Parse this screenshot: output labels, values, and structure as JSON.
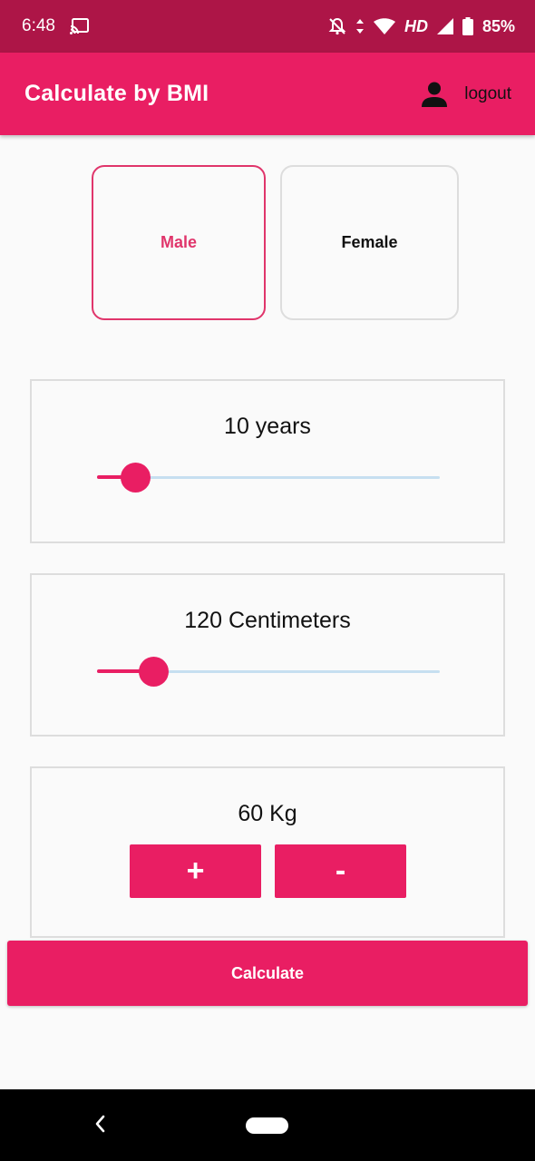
{
  "status_bar": {
    "time": "6:48",
    "network": "HD",
    "battery": "85%",
    "icons": [
      "cast-icon",
      "bell-off-icon",
      "data-arrows-icon",
      "wifi-icon",
      "signal-icon",
      "battery-icon"
    ]
  },
  "app_bar": {
    "title": "Calculate by BMI",
    "logout_label": "logout",
    "icons": [
      "person-icon"
    ]
  },
  "gender": {
    "options": [
      {
        "label": "Male",
        "selected": true
      },
      {
        "label": "Female",
        "selected": false
      }
    ]
  },
  "age": {
    "label": "10 years",
    "value": 10,
    "slider_fraction": 0.11
  },
  "height": {
    "label": "120 Centimeters",
    "value": 120,
    "slider_fraction": 0.165
  },
  "weight": {
    "label": "60 Kg",
    "value": 60,
    "plus_label": "+",
    "minus_label": "-"
  },
  "calculate_label": "Calculate",
  "nav_bar": {
    "icons": [
      "back-icon",
      "home-pill-icon"
    ]
  },
  "colors": {
    "accent": "#e91e63",
    "status_bar": "#ad1547",
    "slider_track": "#c6dff0"
  }
}
